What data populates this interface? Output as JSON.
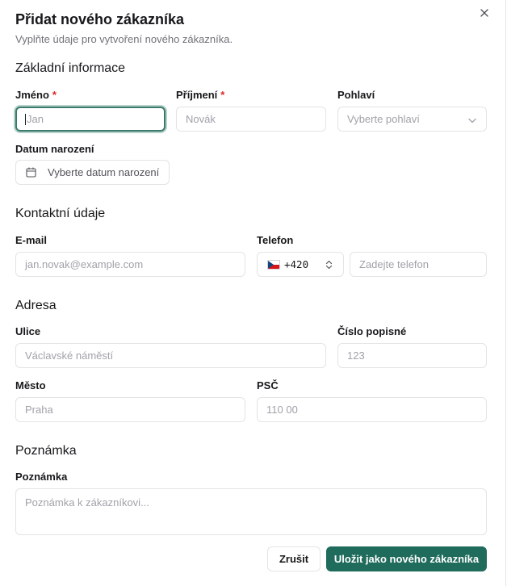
{
  "dialog": {
    "title": "Přidat nového zákazníka",
    "subtitle": "Vyplňte údaje pro vytvoření nového zákazníka."
  },
  "close_icon": "close-icon",
  "sections": {
    "basic": "Základní informace",
    "contact": "Kontaktní údaje",
    "address": "Adresa",
    "note": "Poznámka"
  },
  "fields": {
    "first_name": {
      "label": "Jméno",
      "required_mark": "*",
      "placeholder": "Jan"
    },
    "last_name": {
      "label": "Příjmení",
      "required_mark": "*",
      "placeholder": "Novák"
    },
    "gender": {
      "label": "Pohlaví",
      "placeholder": "Vyberte pohlaví"
    },
    "birth_date": {
      "label": "Datum narození",
      "placeholder": "Vyberte datum narození"
    },
    "email": {
      "label": "E-mail",
      "placeholder": "jan.novak@example.com"
    },
    "phone": {
      "label": "Telefon",
      "country_code": "+420",
      "placeholder": "Zadejte telefon"
    },
    "street": {
      "label": "Ulice",
      "placeholder": "Václavské náměstí"
    },
    "house_number": {
      "label": "Číslo popisné",
      "placeholder": "123"
    },
    "city": {
      "label": "Město",
      "placeholder": "Praha"
    },
    "zip": {
      "label": "PSČ",
      "placeholder": "110 00"
    },
    "note": {
      "label": "Poznámka",
      "placeholder": "Poznámka k zákazníkovi..."
    }
  },
  "buttons": {
    "cancel": "Zrušit",
    "save": "Uložit jako nového zákazníka"
  },
  "colors": {
    "primary": "#1f6b5c",
    "focus_ring": "#3c7a6c",
    "required": "#dc2626"
  }
}
